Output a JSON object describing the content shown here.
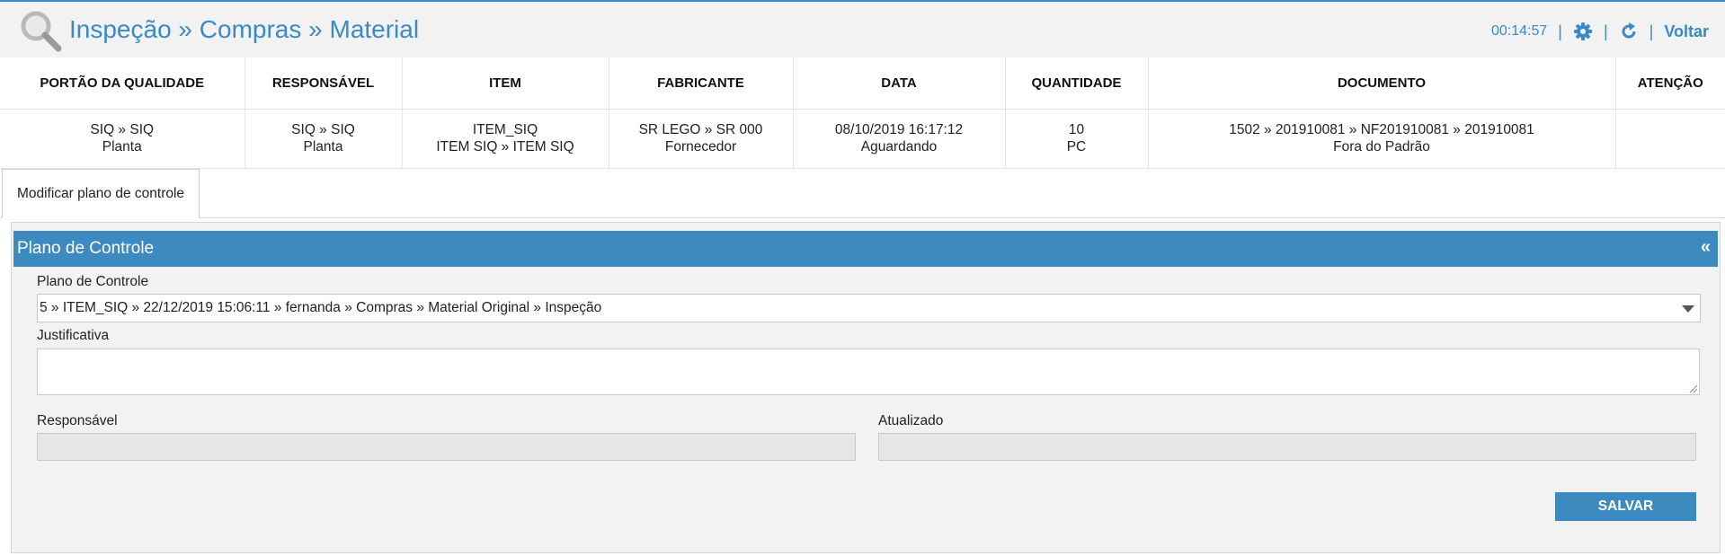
{
  "header": {
    "title": "Inspeção » Compras » Material",
    "timer": "00:14:57",
    "back_label": "Voltar",
    "icons": [
      "magnifier-logo-icon",
      "gear-icon",
      "refresh-icon"
    ],
    "accent_color": "#3a8ac4"
  },
  "info_table": {
    "columns": [
      "PORTÃO DA QUALIDADE",
      "RESPONSÁVEL",
      "ITEM",
      "FABRICANTE",
      "DATA",
      "QUANTIDADE",
      "DOCUMENTO",
      "ATENÇÃO"
    ],
    "row": [
      [
        "SIQ » SIQ",
        "Planta"
      ],
      [
        "SIQ » SIQ",
        "Planta"
      ],
      [
        "ITEM_SIQ",
        "ITEM SIQ » ITEM SIQ"
      ],
      [
        "SR LEGO » SR 000",
        "Fornecedor"
      ],
      [
        "08/10/2019 16:17:12",
        "Aguardando"
      ],
      [
        "10",
        "PC"
      ],
      [
        "1502 » 201910081 » NF201910081 » 201910081",
        "Fora do Padrão"
      ],
      [
        "",
        ""
      ]
    ]
  },
  "tabs": [
    {
      "label": "Modificar plano de controle",
      "active": true
    }
  ],
  "panel": {
    "title": "Plano de Controle",
    "collapse_label": "«",
    "header_color": "#3d8ac0",
    "plan_label": "Plano de Controle",
    "plan_value": "5 » ITEM_SIQ » 22/12/2019 15:06:11 » fernanda » Compras » Material Original » Inspeção",
    "justification_label": "Justificativa",
    "justification_value": "",
    "responsible_label": "Responsável",
    "responsible_value": "",
    "updated_label": "Atualizado",
    "updated_value": "",
    "save_label": "SALVAR"
  }
}
